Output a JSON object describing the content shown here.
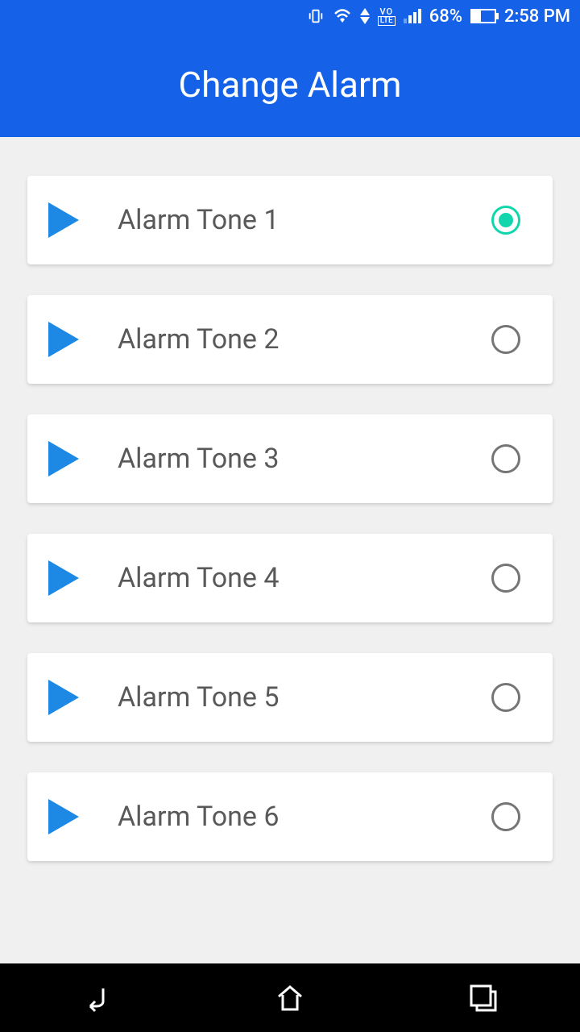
{
  "status": {
    "battery_percent": "68%",
    "time": "2:58 PM"
  },
  "header": {
    "title": "Change Alarm"
  },
  "tones": [
    {
      "label": "Alarm Tone 1",
      "selected": true
    },
    {
      "label": "Alarm Tone 2",
      "selected": false
    },
    {
      "label": "Alarm Tone 3",
      "selected": false
    },
    {
      "label": "Alarm Tone 4",
      "selected": false
    },
    {
      "label": "Alarm Tone 5",
      "selected": false
    },
    {
      "label": "Alarm Tone 6",
      "selected": false
    }
  ]
}
